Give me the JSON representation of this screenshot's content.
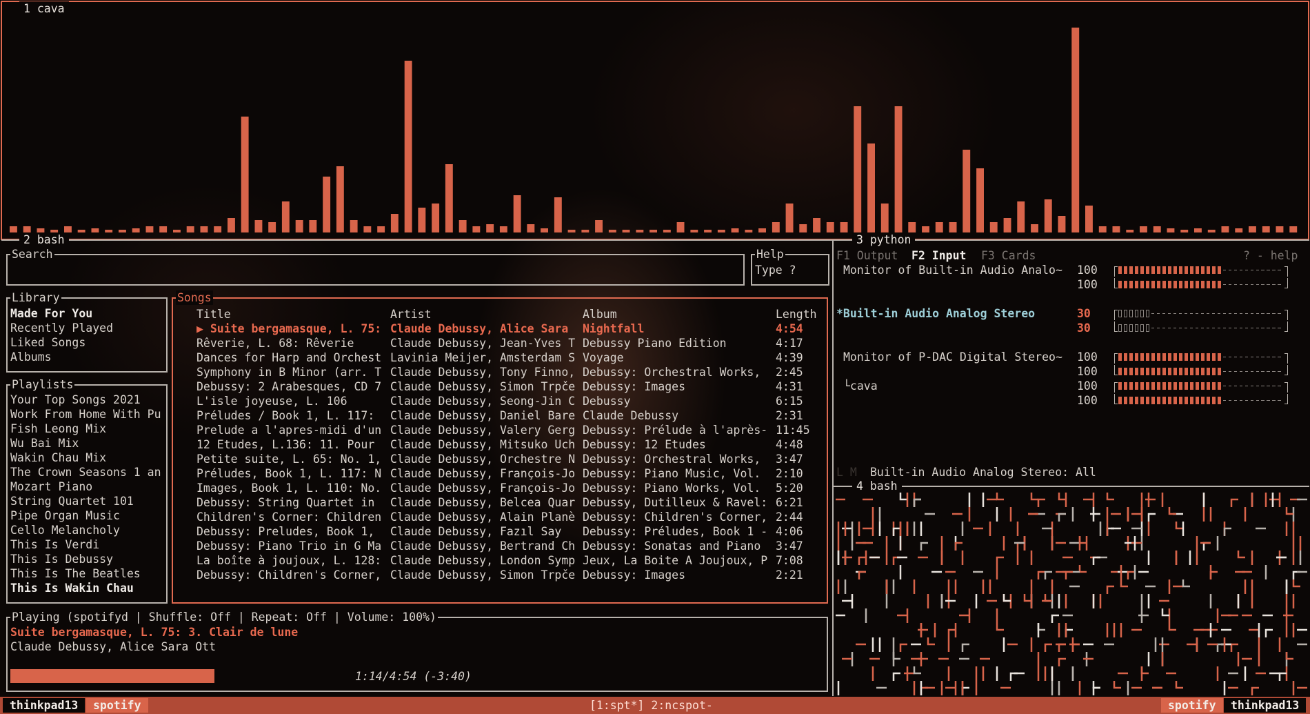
{
  "colors": {
    "accent": "#e06a50",
    "bar": "#d8644a",
    "border": "#b8b2ac"
  },
  "panes": {
    "cava_title": "1 cava",
    "bash_title": "2 bash",
    "python_title": "3 python",
    "bash4_title": "4 bash"
  },
  "cava_bars": [
    0.03,
    0.03,
    0.02,
    0.01,
    0.03,
    0.01,
    0.02,
    0.01,
    0.01,
    0.02,
    0.03,
    0.03,
    0.01,
    0.03,
    0.03,
    0.03,
    0.07,
    0.56,
    0.06,
    0.05,
    0.15,
    0.06,
    0.06,
    0.27,
    0.32,
    0.06,
    0.03,
    0.03,
    0.09,
    0.83,
    0.12,
    0.14,
    0.33,
    0.06,
    0.03,
    0.04,
    0.03,
    0.18,
    0.04,
    0.02,
    0.17,
    0.01,
    0.01,
    0.06,
    0.01,
    0.01,
    0.01,
    0.01,
    0.01,
    0.05,
    0.01,
    0.01,
    0.01,
    0.02,
    0.01,
    0.02,
    0.05,
    0.14,
    0.04,
    0.07,
    0.05,
    0.05,
    0.61,
    0.43,
    0.14,
    0.61,
    0.05,
    0.03,
    0.05,
    0.05,
    0.4,
    0.31,
    0.05,
    0.07,
    0.15,
    0.04,
    0.16,
    0.08,
    0.99,
    0.13,
    0.03,
    0.03,
    0.01,
    0.03,
    0.03,
    0.02,
    0.01,
    0.02,
    0.01,
    0.03,
    0.02,
    0.03,
    0.03,
    0.03,
    0.03
  ],
  "search": {
    "label": "Search",
    "value": ""
  },
  "help": {
    "label": "Help",
    "text": "Type ?"
  },
  "library": {
    "label": "Library",
    "items": [
      "Made For You",
      "Recently Played",
      "Liked Songs",
      "Albums"
    ]
  },
  "playlists": {
    "label": "Playlists",
    "items": [
      "Your Top Songs 2021",
      "Work From Home With Pu",
      "Fish Leong Mix",
      "Wu Bai Mix",
      "Wakin Chau Mix",
      "The Crown Seasons 1 an",
      "Mozart Piano",
      "String Quartet 101",
      "Pipe Organ Music",
      "Cello Melancholy",
      "This Is Verdi",
      "This Is Debussy",
      "This Is The Beatles",
      "This Is Wakin Chau"
    ]
  },
  "songs": {
    "label": "Songs",
    "headers": {
      "title": "Title",
      "artist": "Artist",
      "album": "Album",
      "length": "Length"
    },
    "rows": [
      {
        "title": "▶ Suite bergamasque, L. 75:",
        "artist": "Claude Debussy, Alice Sara",
        "album": "Nightfall",
        "length": "4:54"
      },
      {
        "title": "Rêverie, L. 68: Rêverie",
        "artist": "Claude Debussy, Jean-Yves T",
        "album": "Debussy Piano Edition",
        "length": "4:17"
      },
      {
        "title": "Dances for Harp and Orchest",
        "artist": "Lavinia Meijer, Amsterdam S",
        "album": "Voyage",
        "length": "4:39"
      },
      {
        "title": "Symphony in B Minor (arr. T",
        "artist": "Claude Debussy, Tony Finno,",
        "album": "Debussy: Orchestral Works,",
        "length": "2:45"
      },
      {
        "title": "Debussy: 2 Arabesques, CD 7",
        "artist": "Claude Debussy, Simon Trpče",
        "album": "Debussy: Images",
        "length": "4:31"
      },
      {
        "title": "L'isle joyeuse, L. 106",
        "artist": "Claude Debussy, Seong-Jin C",
        "album": "Debussy",
        "length": "6:15"
      },
      {
        "title": "Préludes / Book 1, L. 117:",
        "artist": "Claude Debussy, Daniel Bare",
        "album": "Claude Debussy",
        "length": "2:31"
      },
      {
        "title": "Prelude a l'apres-midi d'un",
        "artist": "Claude Debussy, Valery Gerg",
        "album": "Debussy: Prélude à l'après-",
        "length": "11:45"
      },
      {
        "title": "12 Etudes, L.136: 11. Pour",
        "artist": "Claude Debussy, Mitsuko Uch",
        "album": "Debussy: 12 Etudes",
        "length": "4:48"
      },
      {
        "title": "Petite suite, L. 65: No. 1,",
        "artist": "Claude Debussy, Orchestre N",
        "album": "Debussy: Orchestral Works,",
        "length": "3:47"
      },
      {
        "title": "Préludes, Book 1, L. 117: N",
        "artist": "Claude Debussy, François-Jo",
        "album": "Debussy: Piano Music, Vol.",
        "length": "2:10"
      },
      {
        "title": "Images, Book 1, L. 110: No.",
        "artist": "Claude Debussy, François-Jo",
        "album": "Debussy: Piano Works, Vol.",
        "length": "5:20"
      },
      {
        "title": "Debussy: String Quartet in",
        "artist": "Claude Debussy, Belcea Quar",
        "album": "Debussy, Dutilleux & Ravel:",
        "length": "6:21"
      },
      {
        "title": "Children's Corner: Children",
        "artist": "Claude Debussy, Alain Planè",
        "album": "Debussy: Children's Corner,",
        "length": "2:44"
      },
      {
        "title": "Debussy: Preludes, Book 1,",
        "artist": "Claude Debussy, Fazıl Say",
        "album": "Debussy: Préludes, Book 1 -",
        "length": "4:06"
      },
      {
        "title": "Debussy: Piano Trio in G Ma",
        "artist": "Claude Debussy, Bertrand Ch",
        "album": "Debussy: Sonatas and Piano",
        "length": "3:47"
      },
      {
        "title": "La boîte à joujoux, L. 128:",
        "artist": "Claude Debussy, London Symp",
        "album": "Jeux, La Boite A Joujoux, P",
        "length": "7:08"
      },
      {
        "title": "Debussy: Children's Corner,",
        "artist": "Claude Debussy, Simon Trpče",
        "album": "Debussy: Images",
        "length": "2:21"
      }
    ]
  },
  "playing": {
    "label": "Playing (spotifyd | Shuffle: Off | Repeat: Off   | Volume: 100%)",
    "track": "Suite bergamasque, L. 75: 3. Clair de lune",
    "artist": "Claude Debussy, Alice Sara Ott",
    "time": "1:14/4:54 (-3:40)",
    "progress": 0.252
  },
  "mixer": {
    "tabs": {
      "f1": "F1 Output",
      "f2": "F2 Input",
      "f3": "F3 Cards",
      "help": "? - help"
    },
    "groups": [
      {
        "name": "Monitor of Built-in Audio Analo~",
        "levels": [
          "100",
          "100"
        ],
        "fill": 0.62,
        "selected": false
      },
      {
        "name": "*Built-in Audio Analog Stereo",
        "levels": [
          "30",
          "30"
        ],
        "fill": 0.2,
        "selected": true
      },
      {
        "name": "Monitor of P-DAC Digital Stereo~",
        "levels": [
          "100",
          "100"
        ],
        "fill": 0.62,
        "selected": false
      },
      {
        "name": "└cava",
        "levels": [
          "100",
          "100"
        ],
        "fill": 0.62,
        "selected": false
      }
    ],
    "lm": "L M",
    "footer": "Built-in Audio Analog Stereo: All"
  },
  "statusbar": {
    "host_left": "thinkpad13",
    "tag_left": "spotify",
    "windows": "[1:spt*] 2:ncspot-",
    "tag_right": "spotify",
    "host_right": "thinkpad13"
  }
}
